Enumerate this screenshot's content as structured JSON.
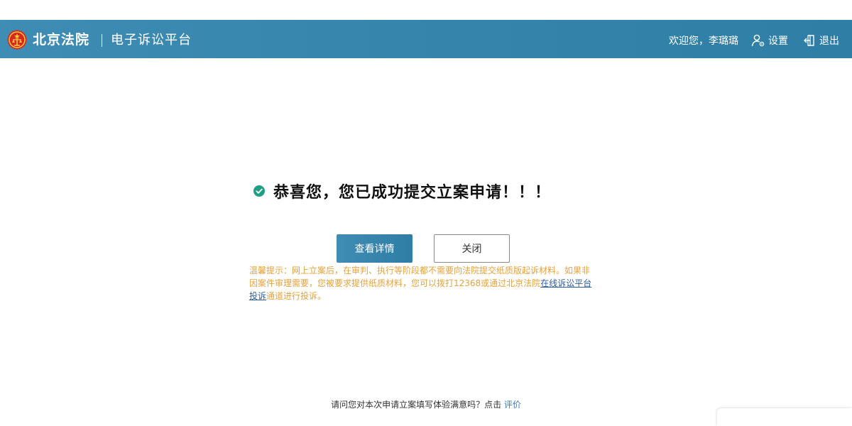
{
  "header": {
    "brand": "北京法院",
    "platform": "电子诉讼平台",
    "welcome": "欢迎您，李璐璐",
    "settings_label": "设置",
    "logout_label": "退出",
    "background_color": "#3686ad",
    "emblem_icon": "court-emblem-icon",
    "settings_icon": "user-gear-icon",
    "logout_icon": "logout-icon"
  },
  "result": {
    "icon": "check-circle-icon",
    "icon_color": "#1e9e84",
    "message": "恭喜您，您已成功提交立案申请！！！"
  },
  "actions": {
    "view_details_label": "查看详情",
    "close_label": "关闭"
  },
  "notice": {
    "text_before": "温馨提示：网上立案后，在审判、执行等阶段都不需要向法院提交纸质版起诉材料。如果非因案件审理需要，您被要求提供纸质材料，您可以拨打12368或通过北京法院",
    "link_text": "在线诉讼平台投诉",
    "text_after": "通道进行投诉。",
    "text_color": "#e6a23c",
    "link_color": "#2e5e9c"
  },
  "survey": {
    "question": "请问您对本次申请立案填写体验满意吗？点击 ",
    "link_text": "评价"
  }
}
